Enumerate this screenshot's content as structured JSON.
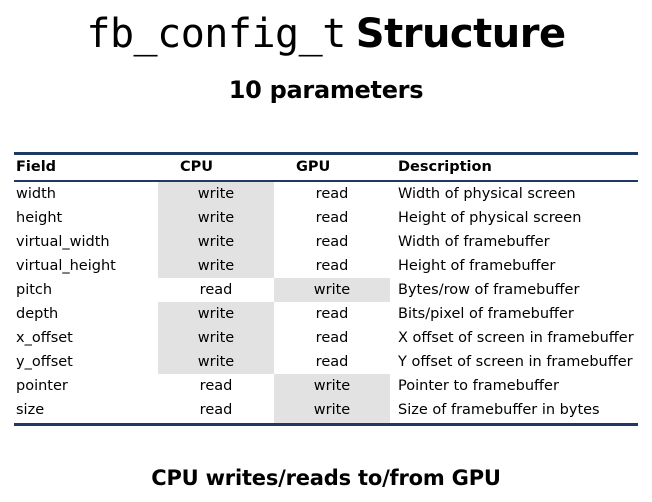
{
  "title": {
    "mono_part": "fb_config_t",
    "bold_part": "Structure"
  },
  "subtitle": "10 parameters",
  "footer": "CPU writes/reads to/from GPU",
  "colors": {
    "rule": "#203864",
    "highlight": "#e2e2e2",
    "text": "#000000",
    "background": "#ffffff"
  },
  "table": {
    "headers": [
      "Field",
      "CPU",
      "GPU",
      "Description"
    ],
    "rows": [
      {
        "field": "width",
        "cpu": "write",
        "gpu": "read",
        "description": "Width of physical screen",
        "highlight": "cpu"
      },
      {
        "field": "height",
        "cpu": "write",
        "gpu": "read",
        "description": "Height of physical screen",
        "highlight": "cpu"
      },
      {
        "field": "virtual_width",
        "cpu": "write",
        "gpu": "read",
        "description": "Width of framebuffer",
        "highlight": "cpu"
      },
      {
        "field": "virtual_height",
        "cpu": "write",
        "gpu": "read",
        "description": "Height of framebuffer",
        "highlight": "cpu"
      },
      {
        "field": "pitch",
        "cpu": "read",
        "gpu": "write",
        "description": "Bytes/row of framebuffer",
        "highlight": "gpu"
      },
      {
        "field": "depth",
        "cpu": "write",
        "gpu": "read",
        "description": "Bits/pixel of framebuffer",
        "highlight": "cpu"
      },
      {
        "field": "x_offset",
        "cpu": "write",
        "gpu": "read",
        "description": "X offset of screen in framebuffer",
        "highlight": "cpu"
      },
      {
        "field": "y_offset",
        "cpu": "write",
        "gpu": "read",
        "description": "Y offset of screen in framebuffer",
        "highlight": "cpu"
      },
      {
        "field": "pointer",
        "cpu": "read",
        "gpu": "write",
        "description": "Pointer to framebuffer",
        "highlight": "gpu"
      },
      {
        "field": "size",
        "cpu": "read",
        "gpu": "write",
        "description": "Size of framebuffer in bytes",
        "highlight": "gpu"
      }
    ]
  }
}
